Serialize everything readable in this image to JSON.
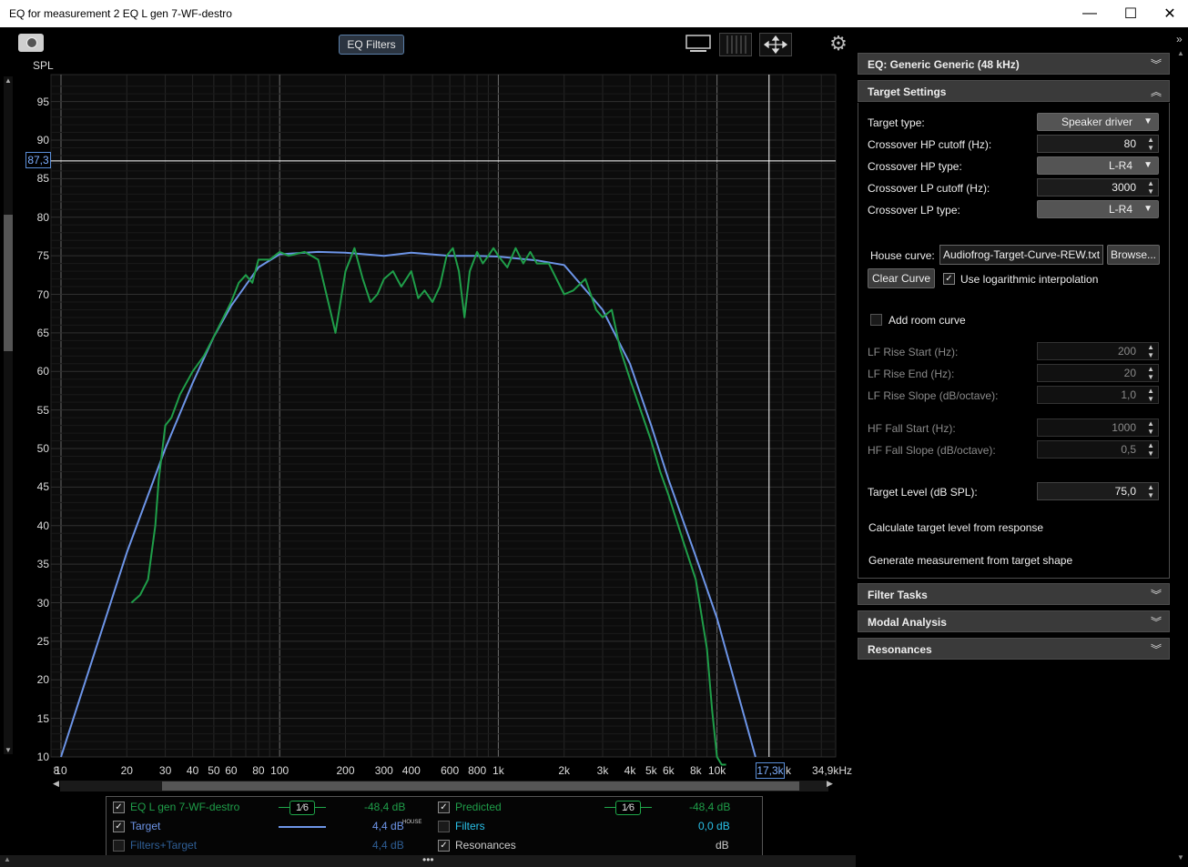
{
  "window": {
    "title": "EQ for measurement 2 EQ L gen 7-WF-destro",
    "minimize": "—",
    "maximize": "☐",
    "close": "✕"
  },
  "toolbar": {
    "eq_filters_label": "EQ Filters",
    "camera_icon": "camera-icon",
    "gear_icon": "gear-icon"
  },
  "chart_data": {
    "type": "line",
    "ylabel": "SPL",
    "xlabel": "",
    "xscale": "log",
    "xlim": [
      8,
      34900
    ],
    "ylim": [
      10,
      97
    ],
    "grid": true,
    "y_ticks": [
      "95",
      "90",
      "85",
      "80",
      "75",
      "70",
      "65",
      "60",
      "55",
      "50",
      "45",
      "40",
      "35",
      "30",
      "25",
      "20",
      "15",
      "10"
    ],
    "x_ticks": [
      {
        "v": 8,
        "label": "8"
      },
      {
        "v": 10,
        "label": "10"
      },
      {
        "v": 20,
        "label": "20"
      },
      {
        "v": 30,
        "label": "30"
      },
      {
        "v": 40,
        "label": "40"
      },
      {
        "v": 50,
        "label": "50"
      },
      {
        "v": 60,
        "label": "60"
      },
      {
        "v": 80,
        "label": "80"
      },
      {
        "v": 100,
        "label": "100"
      },
      {
        "v": 200,
        "label": "200"
      },
      {
        "v": 300,
        "label": "300"
      },
      {
        "v": 400,
        "label": "400"
      },
      {
        "v": 600,
        "label": "600"
      },
      {
        "v": 800,
        "label": "800"
      },
      {
        "v": 1000,
        "label": "1k"
      },
      {
        "v": 2000,
        "label": "2k"
      },
      {
        "v": 3000,
        "label": "3k"
      },
      {
        "v": 4000,
        "label": "4k"
      },
      {
        "v": 5000,
        "label": "5k"
      },
      {
        "v": 6000,
        "label": "6k"
      },
      {
        "v": 8000,
        "label": "8k"
      },
      {
        "v": 10000,
        "label": "10k"
      },
      {
        "v": 20000,
        "label": "k"
      },
      {
        "v": 34900,
        "label": "34,9kHz"
      }
    ],
    "cursor": {
      "y": 87.3,
      "y_label": "87,3",
      "x": 17300,
      "x_label": "17,3k"
    },
    "series": [
      {
        "name": "Target",
        "color": "#6d95e8",
        "x": [
          10,
          20,
          30,
          40,
          50,
          60,
          80,
          100,
          150,
          200,
          300,
          400,
          600,
          800,
          1000,
          1500,
          2000,
          3000,
          4000,
          5000,
          6000,
          8000,
          10000,
          15000
        ],
        "y": [
          10,
          36.5,
          50,
          58.5,
          64.5,
          68.5,
          73.5,
          75.2,
          75.5,
          75.4,
          75,
          75.4,
          75,
          75,
          74.9,
          74.4,
          73.8,
          68,
          61,
          53,
          46,
          36,
          28,
          10
        ]
      },
      {
        "name": "Predicted",
        "color": "#1f9e49",
        "x": [
          21,
          23,
          25,
          27,
          28,
          30,
          32,
          35,
          40,
          45,
          50,
          60,
          65,
          70,
          75,
          80,
          90,
          100,
          110,
          130,
          150,
          170,
          180,
          200,
          220,
          240,
          260,
          280,
          300,
          330,
          360,
          400,
          430,
          460,
          500,
          540,
          580,
          620,
          660,
          700,
          740,
          800,
          850,
          900,
          950,
          1000,
          1100,
          1200,
          1300,
          1400,
          1500,
          1700,
          2000,
          2200,
          2500,
          2800,
          3000,
          3300,
          3600,
          4000,
          5000,
          5500,
          6000,
          7000,
          8000,
          9000,
          9500,
          10000,
          10500,
          11000
        ],
        "y": [
          30,
          31,
          33,
          40,
          46,
          53,
          54,
          57,
          60,
          62,
          64.5,
          69,
          71.5,
          72.5,
          71.5,
          74.5,
          74.5,
          75.5,
          75,
          75.5,
          74.5,
          68,
          65,
          73,
          76,
          72,
          69,
          70,
          72,
          73,
          71,
          73,
          69.5,
          70.5,
          69,
          71,
          75,
          76,
          73,
          67,
          73,
          75.5,
          74,
          75,
          76,
          75,
          73.5,
          76,
          74,
          75.5,
          74,
          74,
          70,
          70.5,
          72,
          68,
          67,
          68,
          63,
          59,
          51,
          47,
          44,
          38,
          33,
          24,
          16,
          10,
          8,
          5
        ]
      }
    ]
  },
  "legend": {
    "rows": [
      {
        "label": "EQ L gen 7-WF-destro",
        "checked": "✓",
        "smoothing": "1⁄6",
        "value": "-48,4 dB",
        "color": "#1f9e49"
      },
      {
        "label": "Target",
        "checked": "✓",
        "value": "4,4 dB",
        "suffix": "HOUSE",
        "color": "#6d95e8"
      },
      {
        "label": "Filters+Target",
        "checked": "",
        "value": "4,4 dB",
        "color": "#2f5f96"
      }
    ],
    "rows2": [
      {
        "label": "Predicted",
        "checked": "✓",
        "smoothing": "1⁄6",
        "value": "-48,4 dB",
        "color": "#1f9e49"
      },
      {
        "label": "Filters",
        "checked": "",
        "value": "0,0 dB",
        "color": "#29c0e8"
      },
      {
        "label": "Resonances",
        "checked": "✓",
        "value": "dB",
        "color": "#cccccc"
      }
    ]
  },
  "panel": {
    "eq_header": "EQ: Generic Generic (48 kHz)",
    "target_settings": "Target Settings",
    "target_type_label": "Target type:",
    "target_type_value": "Speaker driver",
    "hp_cutoff_label": "Crossover HP cutoff (Hz):",
    "hp_cutoff_value": "80",
    "hp_type_label": "Crossover HP type:",
    "hp_type_value": "L-R4",
    "lp_cutoff_label": "Crossover LP cutoff (Hz):",
    "lp_cutoff_value": "3000",
    "lp_type_label": "Crossover LP type:",
    "lp_type_value": "L-R4",
    "house_curve_label": "House curve:",
    "house_curve_value": "Audiofrog-Target-Curve-REW.txt",
    "browse_label": "Browse...",
    "clear_curve_label": "Clear Curve",
    "log_interp_label": "Use logarithmic interpolation",
    "log_interp_checked": "✓",
    "add_room_label": "Add room curve",
    "lf_rise_start_label": "LF Rise Start (Hz):",
    "lf_rise_start_value": "200",
    "lf_rise_end_label": "LF Rise End (Hz):",
    "lf_rise_end_value": "20",
    "lf_rise_slope_label": "LF Rise Slope (dB/octave):",
    "lf_rise_slope_value": "1,0",
    "hf_fall_start_label": "HF Fall Start (Hz):",
    "hf_fall_start_value": "1000",
    "hf_fall_slope_label": "HF Fall Slope (dB/octave):",
    "hf_fall_slope_value": "0,5",
    "target_level_label": "Target Level (dB SPL):",
    "target_level_value": "75,0",
    "calc_target_label": "Calculate target level from response",
    "generate_label": "Generate measurement from target shape",
    "filter_tasks": "Filter Tasks",
    "modal_analysis": "Modal Analysis",
    "resonances": "Resonances"
  }
}
